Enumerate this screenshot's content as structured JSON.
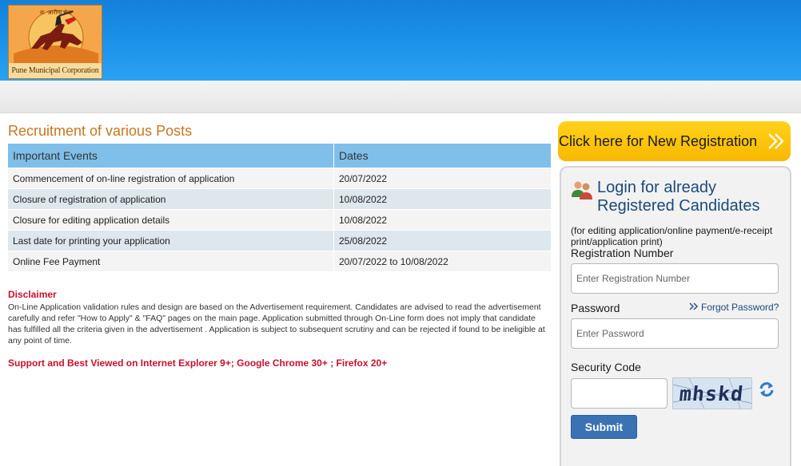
{
  "header": {
    "logo_caption": "Pune Municipal Corporation",
    "logo_motto": "रा. आरोग्य सेवा"
  },
  "main": {
    "title": "Recruitment of various Posts",
    "table": {
      "headers": [
        "Important Events",
        "Dates"
      ],
      "rows": [
        {
          "event": "Commencement of on-line registration of application",
          "date": "20/07/2022"
        },
        {
          "event": "Closure of registration of application",
          "date": "10/08/2022"
        },
        {
          "event": "Closure for editing application details",
          "date": "10/08/2022"
        },
        {
          "event": "Last date for printing your application",
          "date": "25/08/2022"
        },
        {
          "event": "Online Fee Payment",
          "date": "20/07/2022 to 10/08/2022"
        }
      ]
    },
    "disclaimer_title": "Disclaimer",
    "disclaimer_text": "On-Line Application validation rules and design are based on the Advertisement requirement. Candidates are advised to read the advertisement carefully and refer \"How to Apply\" & \"FAQ\" pages on the main page. Application submitted through On-Line form does not imply that candidate has fulfilled all the criteria given in the advertisement . Application is subject to subsequent scrutiny and can be rejected if found to be ineligible at any point of time.",
    "browser_support": "Support and Best Viewed on Internet Explorer 9+; Google Chrome 30+ ; Firefox 20+"
  },
  "sidebar": {
    "new_registration_label": "Click here for New Registration",
    "login": {
      "title": "Login for already Registered Candidates",
      "note": "(for editing application/online payment/e-receipt print/application print)",
      "registration_label": "Registration Number",
      "registration_placeholder": "Enter Registration Number",
      "password_label": "Password",
      "forgot_password": "Forgot Password?",
      "password_placeholder": "Enter Password",
      "security_code_label": "Security Code",
      "captcha_text": "mhskd",
      "submit_label": "Submit"
    }
  },
  "colors": {
    "header_blue": "#1a8fe8",
    "title_orange": "#c8761e",
    "table_header": "#7fbfea",
    "alert_red": "#c8102e",
    "registration_yellow": "#ffcc00",
    "submit_blue": "#3a72b4"
  },
  "icons": {
    "new_registration": "double-chevron-right-icon",
    "login": "users-group-icon",
    "forgot_password": "double-chevron-right-icon",
    "captcha_refresh": "refresh-icon"
  }
}
